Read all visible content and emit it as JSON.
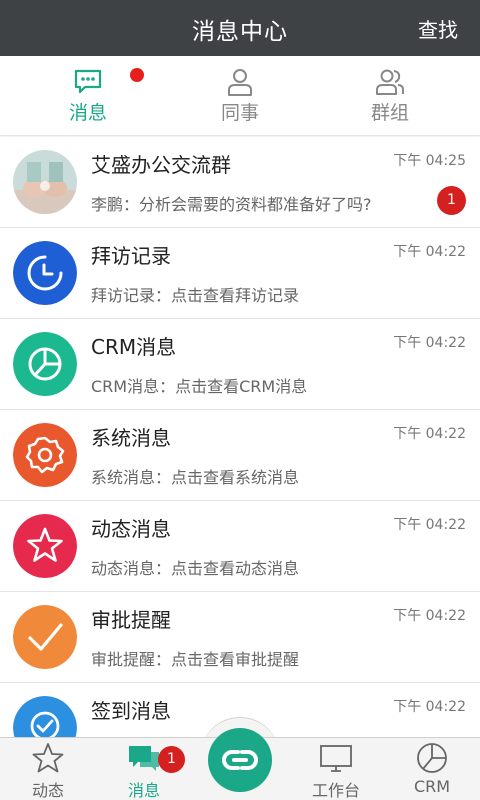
{
  "header": {
    "title": "消息中心",
    "search_label": "查找"
  },
  "tabs": [
    {
      "label": "消息",
      "icon": "chat-bubble-icon",
      "active": true,
      "has_dot": true
    },
    {
      "label": "同事",
      "icon": "person-icon",
      "active": false
    },
    {
      "label": "群组",
      "icon": "group-icon",
      "active": false
    }
  ],
  "messages": [
    {
      "name": "艾盛办公交流群",
      "time": "下午 04:25",
      "preview": "李鹏：分析会需要的资料都准备好了吗?",
      "badge": "1",
      "avatar": "group-photo"
    },
    {
      "name": "拜访记录",
      "time": "下午 04:22",
      "preview": "拜访记录：点击查看拜访记录",
      "avatar": "clock-icon",
      "color": "#1f5fd6"
    },
    {
      "name": "CRM消息",
      "time": "下午 04:22",
      "preview": "CRM消息：点击查看CRM消息",
      "avatar": "pie-chart-icon",
      "color": "#1cb890"
    },
    {
      "name": "系统消息",
      "time": "下午 04:22",
      "preview": "系统消息：点击查看系统消息",
      "avatar": "gear-icon",
      "color": "#e8582c"
    },
    {
      "name": "动态消息",
      "time": "下午 04:22",
      "preview": "动态消息：点击查看动态消息",
      "avatar": "star-icon",
      "color": "#e62a4d"
    },
    {
      "name": "审批提醒",
      "time": "下午 04:22",
      "preview": "审批提醒：点击查看审批提醒",
      "avatar": "check-icon",
      "color": "#f08a3a"
    },
    {
      "name": "签到消息",
      "time": "下午 04:22",
      "preview": "",
      "avatar": "location-check-icon",
      "color": "#2d8fe0"
    }
  ],
  "bottom_nav": [
    {
      "label": "动态",
      "icon": "star-outline-icon",
      "active": false
    },
    {
      "label": "消息",
      "icon": "chat-bubbles-icon",
      "active": true,
      "badge": "1"
    },
    {
      "label": "",
      "icon": "link-icon",
      "center": true
    },
    {
      "label": "工作台",
      "icon": "monitor-icon",
      "active": false
    },
    {
      "label": "CRM",
      "icon": "pie-chart-outline-icon",
      "active": false
    }
  ],
  "colors": {
    "header_bg": "#3f4245",
    "accent": "#1aa889",
    "badge": "#d52020"
  }
}
